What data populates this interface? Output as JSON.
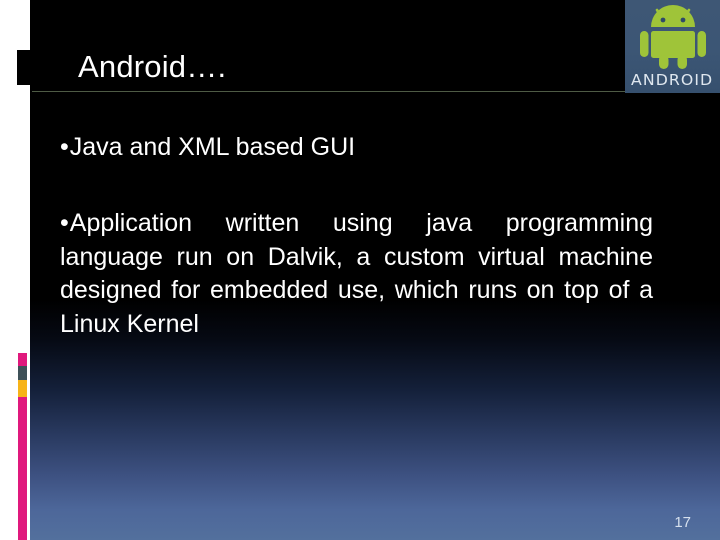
{
  "slide": {
    "title": "Android….",
    "page_number": "17",
    "colors": {
      "background_top": "#000000",
      "background_bottom": "#53709d",
      "title_rule": "#4e5b45",
      "text": "#ffffff",
      "accent_magenta": "#e0197d",
      "accent_yellow": "#f7b318",
      "accent_slate": "#3f5158",
      "android_green": "#a4c639",
      "badge_background": "#3c5675"
    }
  },
  "logo": {
    "name": "android-logo",
    "wordmark": "ANDROID",
    "robot_icon": "android-robot-icon"
  },
  "content": {
    "bullets": [
      {
        "marker": "•",
        "text": "Java and XML based GUI"
      },
      {
        "marker": "•",
        "text": "Application written using java programming language run on Dalvik, a custom virtual machine designed for embedded use, which runs on top of a Linux Kernel"
      }
    ]
  },
  "decorations": {
    "black_block": "decorative-black-block",
    "chip_pink": "decorative-chip-pink",
    "chip_slate": "decorative-chip-slate",
    "chip_yellow": "decorative-chip-yellow",
    "bar_magenta": "decorative-bar-magenta"
  }
}
